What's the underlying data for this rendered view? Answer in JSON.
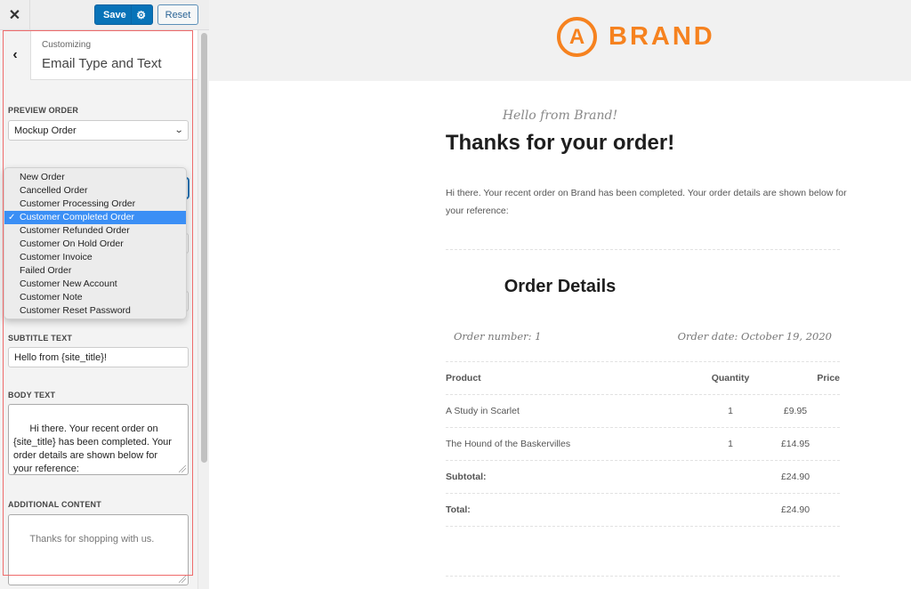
{
  "topbar": {
    "close_icon": "close-icon",
    "save_label": "Save",
    "settings_icon": "gear-icon",
    "reset_label": "Reset"
  },
  "panel": {
    "back_icon": "chevron-left-icon",
    "breadcrumb": "Customizing",
    "title": "Email Type and Text"
  },
  "fields": {
    "preview_order": {
      "label": "PREVIEW ORDER",
      "value": "Mockup Order"
    },
    "email_type_dropdown": {
      "options": [
        "New Order",
        "Cancelled Order",
        "Customer Processing Order",
        "Customer Completed Order",
        "Customer Refunded Order",
        "Customer On Hold Order",
        "Customer Invoice",
        "Failed Order",
        "Customer New Account",
        "Customer Note",
        "Customer Reset Password"
      ],
      "selected": "Customer Completed Order",
      "check": "✓"
    },
    "heading_text": {
      "value": "Thanks for your order!"
    },
    "subtitle_text": {
      "label": "SUBTITLE TEXT",
      "value": "Hello from {site_title}!"
    },
    "body_text": {
      "label": "BODY TEXT",
      "value": "Hi there. Your recent order on\n{site_title} has been completed. Your\norder details are shown below for\nyour reference:"
    },
    "additional_content": {
      "label": "ADDITIONAL CONTENT",
      "placeholder": "Thanks for shopping with us."
    }
  },
  "preview": {
    "brand": {
      "logo_letter": "A",
      "name": "BRAND",
      "color": "#f6821f"
    },
    "subtitle": "Hello from Brand!",
    "heading": "Thanks for your order!",
    "body": "Hi there. Your recent order on Brand has been completed. Your order details are shown below for your reference:",
    "order_details_title": "Order Details",
    "order_number": "Order number: 1",
    "order_date": "Order date: October 19, 2020",
    "table": {
      "headers": [
        "Product",
        "Quantity",
        "Price"
      ],
      "rows": [
        {
          "product": "A Study in Scarlet",
          "quantity": "1",
          "price": "£9.95"
        },
        {
          "product": "The Hound of the Baskervilles",
          "quantity": "1",
          "price": "£14.95"
        }
      ],
      "subtotal_label": "Subtotal:",
      "subtotal": "£24.90",
      "total_label": "Total:",
      "total": "£24.90"
    }
  },
  "colors": {
    "primary_button": "#0873b8",
    "highlight_outline": "#ef6b6b",
    "selected_option": "#3b8ff5"
  }
}
